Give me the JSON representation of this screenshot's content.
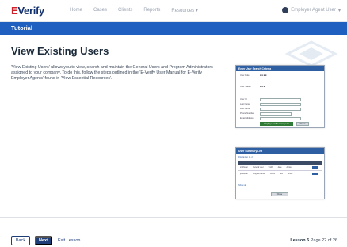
{
  "nav": {
    "brand_e": "E",
    "brand_rest": "Verify",
    "links": [
      "Home",
      "Cases",
      "Clients",
      "Reports",
      "Resources"
    ],
    "user_label": "Employer Agent User"
  },
  "tutorial_bar": {
    "label": "Tutorial"
  },
  "main": {
    "title": "View Existing Users",
    "description": "'View Existing Users' allows you to view, search and maintain the General Users and Program Administrators assigned to your company. To do this, follow the steps outlined in the 'E-Verify User Manual for E-Verify Employer Agents' found in 'View Essential Resources'."
  },
  "screenshot1": {
    "header": "Enter User Search Criteria",
    "rows": [
      "User Role",
      "User Status",
      "User ID",
      "Last Name",
      "First Name",
      "Phone Number",
      "Email Address"
    ],
    "submit": "Display User Summary List",
    "reset": "Reset"
  },
  "screenshot2": {
    "header": "User Summary List",
    "subtitle": "Displaying 1 - 2",
    "rows": [
      [
        "smithuser",
        "General User",
        "Smith",
        "Jane",
        "Active"
      ],
      [
        "jonesuser",
        "Program Admin",
        "Jones",
        "Bob",
        "Active"
      ]
    ],
    "link": "Show all",
    "button": "Close"
  },
  "footer": {
    "back": "Back",
    "next": "Next",
    "exit": "Exit Lesson",
    "lesson": "Lesson 5",
    "page": "Page 22 of 26"
  },
  "colors": {
    "brand_red": "#d0202a",
    "brand_navy": "#12306b",
    "tutorial_bar": "#1f5fbf",
    "button_navy": "#1f3e78"
  }
}
